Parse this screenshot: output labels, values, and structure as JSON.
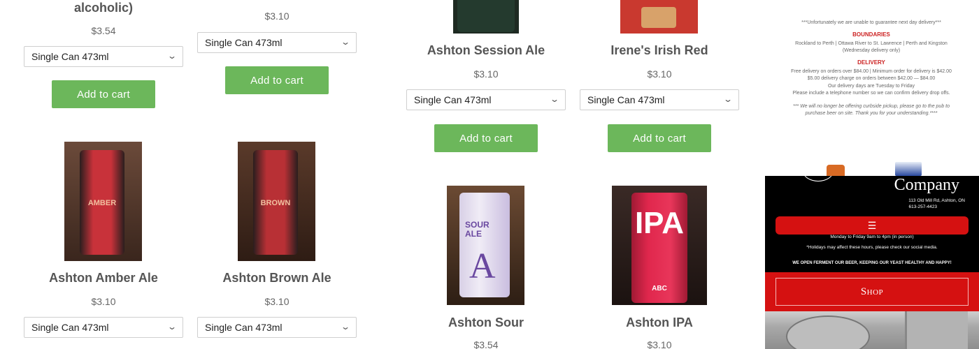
{
  "products": [
    {
      "name": "alcoholic)",
      "price": "$3.54",
      "variant": "Single Can 473ml",
      "cta": "Add to cart"
    },
    {
      "name": "",
      "price": "$3.10",
      "variant": "Single Can 473ml",
      "cta": "Add to cart"
    },
    {
      "name": "Ashton Session Ale",
      "price": "$3.10",
      "variant": "Single Can 473ml",
      "cta": "Add to cart"
    },
    {
      "name": "Irene's Irish Red",
      "price": "$3.10",
      "variant": "Single Can 473ml",
      "cta": "Add to cart"
    },
    {
      "name": "Ashton Amber Ale",
      "price": "$3.10",
      "variant": "Single Can 473ml",
      "can_label": "AMBER ALE",
      "can_color": "#c8323a"
    },
    {
      "name": "Ashton Brown Ale",
      "price": "$3.10",
      "variant": "Single Can 473ml",
      "can_label": "BROWN ALE",
      "can_color": "#b83035"
    },
    {
      "name": "Ashton Sour",
      "price": "$3.54",
      "can_label": "SOUR ALE",
      "can_color": "#7a55a8"
    },
    {
      "name": "Ashton IPA",
      "price": "$3.10",
      "can_label": "IPA",
      "can_color": "#e0274d"
    }
  ],
  "delivery": {
    "notice": "***Unfortunately we are unable to guarantee next day delivery***",
    "boundaries_heading": "BOUNDARIES",
    "boundaries_text": "Rockland to Perth | Ottawa River to St. Lawrence | Perth and Kingston (Wednesday delivery only)",
    "delivery_heading": "DELIVERY",
    "line1": "Free delivery on orders over $84.00 | Minimum order for delivery is $42.00",
    "line2": "$5.00 delivery charge on orders between $42.00 — $84.00",
    "line3": "Our delivery days are Tuesday to Friday",
    "line4": "Please include a telephone number so we can confirm delivery drop offs.",
    "curbside": "*** We will no longer be offering curbside pickup, please go to the pub to purchase beer on site. Thank you for your understanding.****"
  },
  "mobile": {
    "company": "Company",
    "address": "113 Old Mill Rd, Ashton, ON",
    "phone": "613-257-4423",
    "menu_icon": "☰",
    "hours": "Monday to Friday 9am to 4pm (in person)",
    "holidays": "*Holidays may affect these hours, please check our social media.",
    "ferment": "WE OPEN FERMENT OUR BEER, KEEPING OUR YEAST HEALTHY AND HAPPY!",
    "shop": "Shop"
  },
  "colors": {
    "button_green": "#6cb75b",
    "brand_red": "#d51111"
  }
}
